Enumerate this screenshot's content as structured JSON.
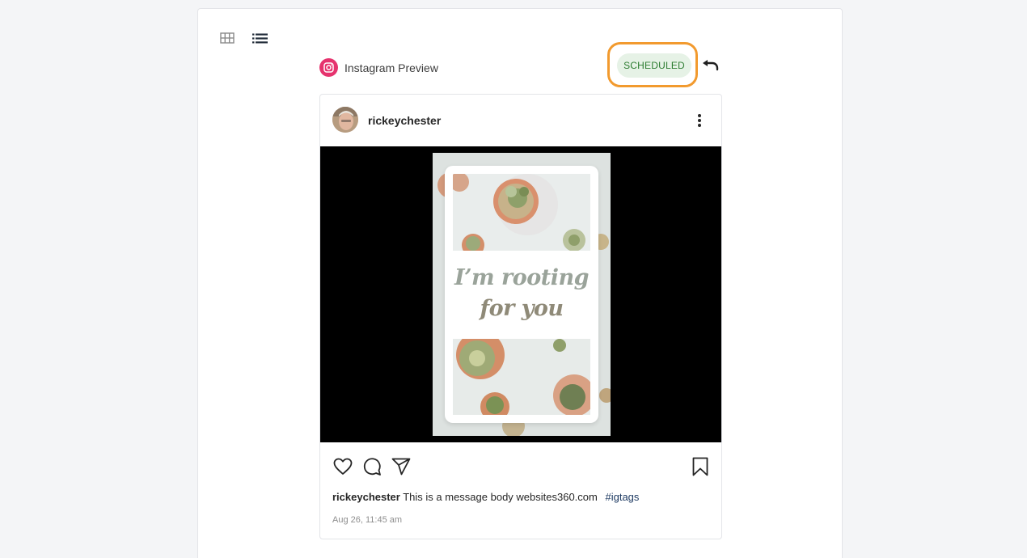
{
  "view_toggle": {
    "grid_icon": "grid-icon",
    "list_icon": "list-icon"
  },
  "preview": {
    "network_icon": "instagram-icon",
    "label": "Instagram Preview",
    "status": "SCHEDULED",
    "undo_icon": "undo-icon"
  },
  "post": {
    "username": "rickeychester",
    "more_icon": "more-vertical-icon",
    "image_text_line1": "I’m rooting",
    "image_text_line2": "for you",
    "actions": {
      "like_icon": "heart-icon",
      "comment_icon": "comment-icon",
      "share_icon": "send-icon",
      "save_icon": "bookmark-icon"
    },
    "caption": {
      "username": "rickeychester",
      "text": "This is a message body websites360.com",
      "tag": "#igtags"
    },
    "timestamp": "Aug 26, 11:45 am"
  },
  "colors": {
    "instagram_pink": "#e6336e",
    "status_bg": "#e6f2e6",
    "status_text": "#2e7d32",
    "highlight_ring": "#f29a2e"
  }
}
